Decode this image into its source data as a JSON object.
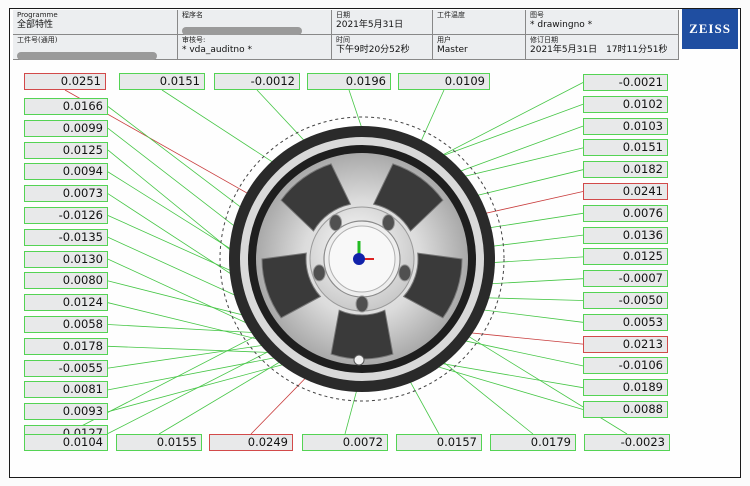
{
  "header": {
    "programme_label": "Programme",
    "programme_value": "全部特性",
    "part_no_label": "工件号(通用)",
    "program_name_label": "程序名",
    "review_no_label": "审核号:",
    "review_no_value": "* vda_auditno *",
    "date_label": "日期",
    "date_value": "2021年5月31日",
    "time_label": "时间",
    "time_value": "下午9时20分52秒",
    "temp_label": "工件温度",
    "user_label": "用户",
    "user_value": "Master",
    "drawing_label": "图号",
    "drawing_value": "* drawingno *",
    "revision_label": "修订日期",
    "revision_value": "2021年5月31日　17时11分51秒",
    "logo_text": "ZEISS"
  },
  "colors": {
    "ok_border": "#54d354",
    "fail_border": "#d24a4a",
    "leader_line": "#46c646"
  },
  "measurements": {
    "top": [
      "0.0251",
      "0.0151",
      "-0.0012",
      "0.0196",
      "0.0109"
    ],
    "left": [
      "0.0166",
      "0.0099",
      "0.0125",
      "0.0094",
      "0.0073",
      "-0.0126",
      "-0.0135",
      "0.0130",
      "0.0080",
      "0.0124",
      "0.0058",
      "0.0178",
      "-0.0055",
      "0.0081",
      "0.0093",
      "0.0127"
    ],
    "bottom": [
      "0.0104",
      "0.0155",
      "0.0249",
      "0.0072",
      "0.0157",
      "0.0179",
      "-0.0023"
    ],
    "right": [
      "-0.0021",
      "0.0102",
      "0.0103",
      "0.0151",
      "0.0182",
      "0.0241",
      "0.0076",
      "0.0136",
      "0.0125",
      "-0.0007",
      "-0.0050",
      "0.0053",
      "0.0213",
      "-0.0106",
      "0.0189",
      "0.0088"
    ]
  },
  "status": {
    "top": [
      "fail",
      "ok",
      "ok",
      "ok",
      "ok"
    ],
    "left": [
      "ok",
      "ok",
      "ok",
      "ok",
      "ok",
      "ok",
      "ok",
      "ok",
      "ok",
      "ok",
      "ok",
      "ok",
      "ok",
      "ok",
      "ok",
      "ok"
    ],
    "bottom": [
      "ok",
      "ok",
      "fail",
      "ok",
      "ok",
      "ok",
      "ok"
    ],
    "right": [
      "ok",
      "ok",
      "ok",
      "ok",
      "ok",
      "fail",
      "ok",
      "ok",
      "ok",
      "ok",
      "ok",
      "ok",
      "fail",
      "ok",
      "ok",
      "ok"
    ]
  }
}
